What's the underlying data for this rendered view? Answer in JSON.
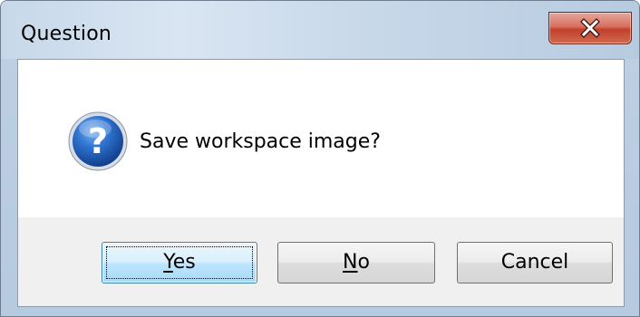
{
  "window": {
    "title": "Question"
  },
  "titlebar": {
    "close_icon": "close-icon"
  },
  "message": {
    "icon": "question-icon",
    "text": "Save workspace image?"
  },
  "buttons": {
    "yes": {
      "accel": "Y",
      "rest": "es"
    },
    "no": {
      "accel": "N",
      "rest": "o"
    },
    "cancel": {
      "label": "Cancel"
    }
  },
  "colors": {
    "close_button": "#c2402b",
    "question_icon_blue": "#1f5fb8",
    "default_button_border": "#3c7fb1"
  }
}
